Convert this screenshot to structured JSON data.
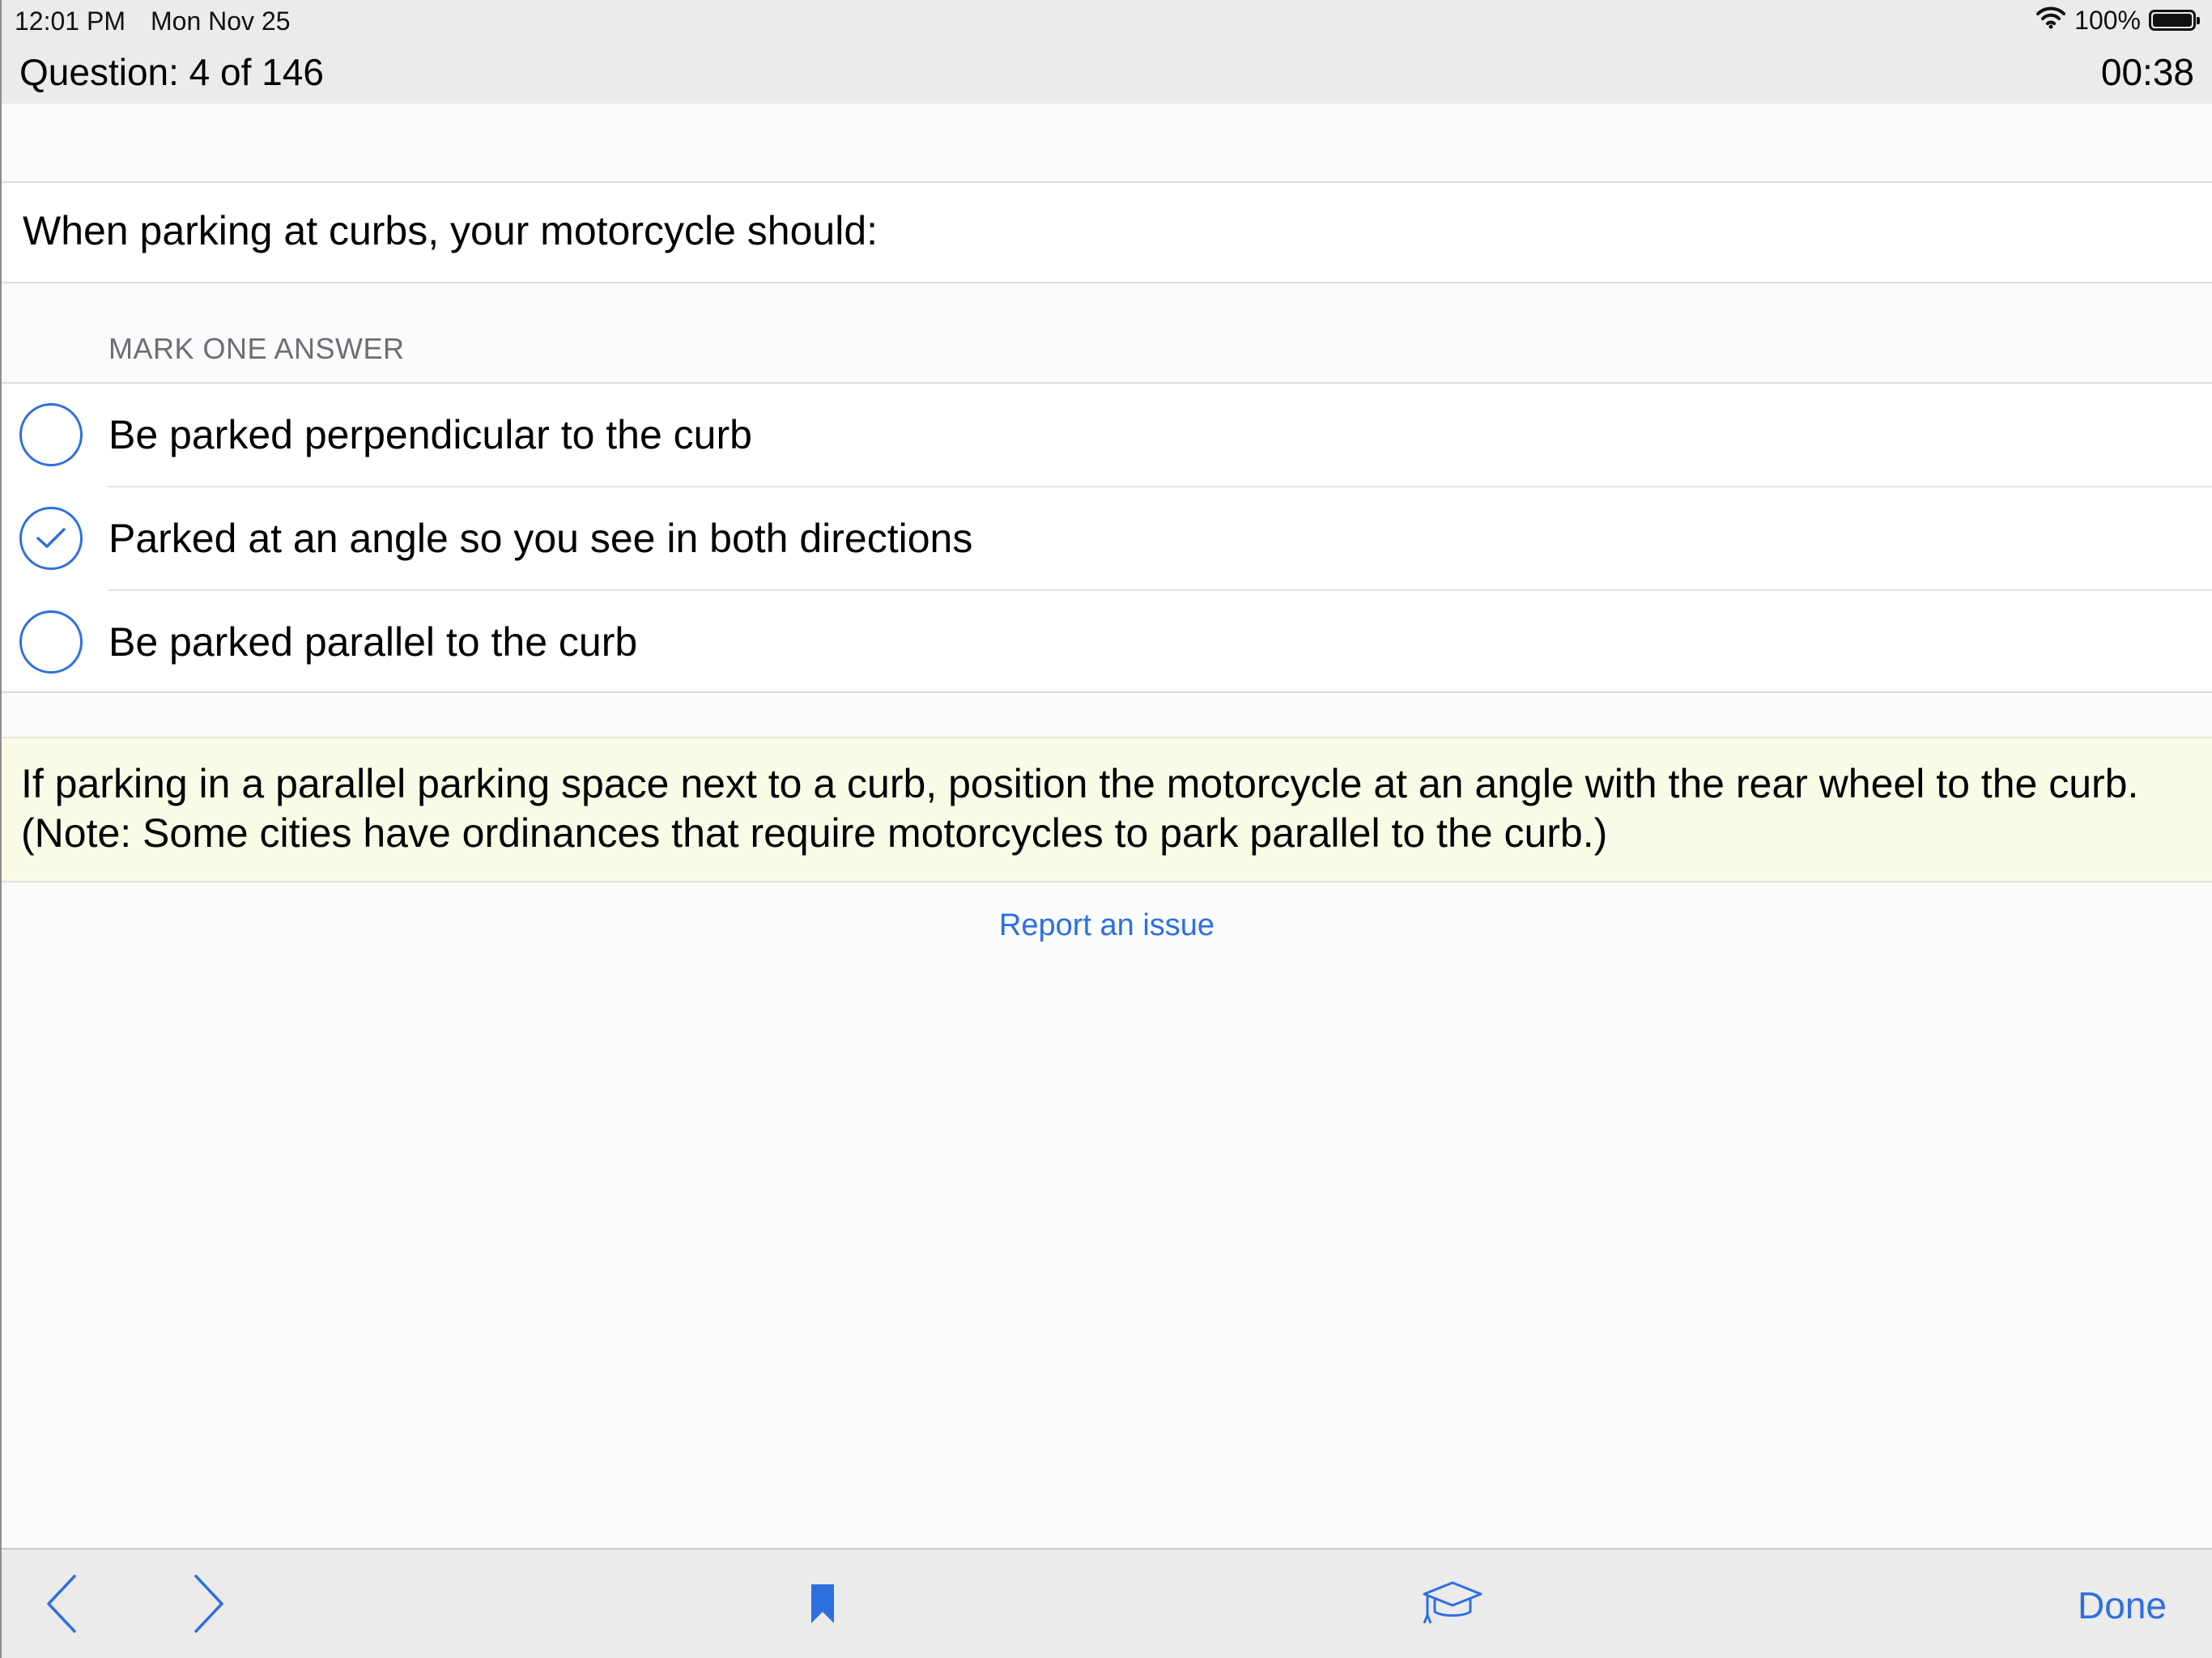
{
  "status_bar": {
    "time": "12:01 PM",
    "date": "Mon Nov 25",
    "battery": "100%",
    "wifi_icon": "wifi-icon",
    "battery_icon": "battery-icon"
  },
  "header": {
    "counter": "Question: 4 of 146",
    "timer": "00:38"
  },
  "question": {
    "text": "When parking at curbs, your motorcycle should:"
  },
  "answers_section": {
    "label": "MARK ONE ANSWER",
    "items": [
      {
        "label": "Be parked perpendicular to the curb",
        "selected": false
      },
      {
        "label": "Parked at an angle so you see in both directions",
        "selected": true
      },
      {
        "label": "Be parked parallel to the curb",
        "selected": false
      }
    ]
  },
  "explanation": {
    "line1": "If parking in a parallel parking space next to a curb, position the motorcycle at an angle with the rear wheel to the curb.",
    "line2": "(Note: Some cities have ordinances that require motorcycles to park parallel to the curb.)"
  },
  "report": {
    "label": "Report an issue"
  },
  "toolbar": {
    "done_label": "Done",
    "icons": [
      "chevron-left-icon",
      "chevron-right-icon",
      "bookmark-icon",
      "graduation-cap-icon"
    ]
  },
  "colors": {
    "accent": "#2e6fe0",
    "bar_background": "#ebebeb",
    "explanation_background": "#fafbe6"
  }
}
